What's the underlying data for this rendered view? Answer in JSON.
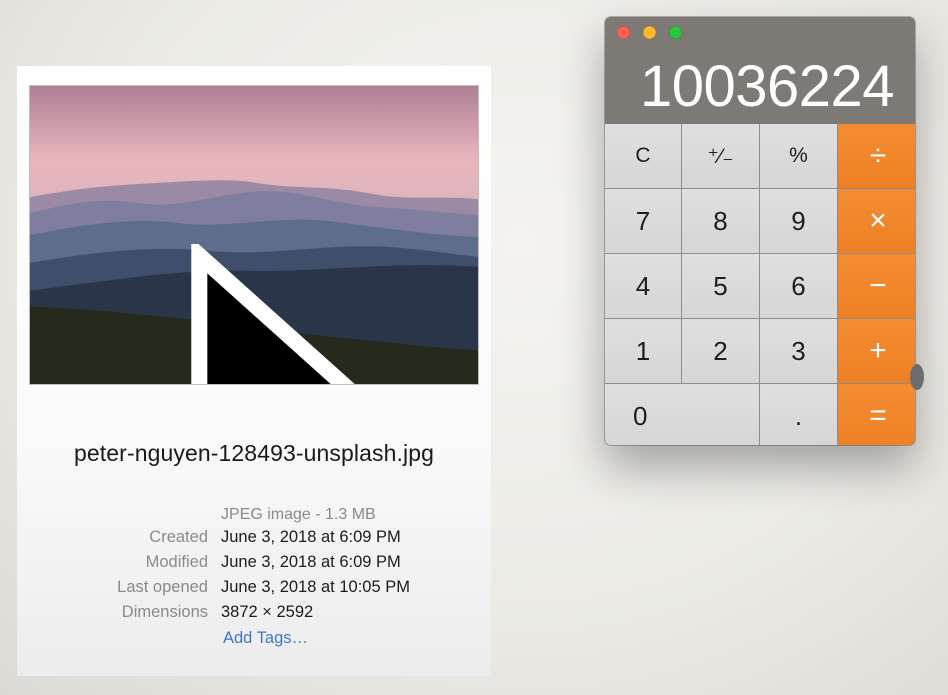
{
  "info_panel": {
    "file_name": "peter-nguyen-128493-unsplash.jpg",
    "kind": "JPEG image - 1.3 MB",
    "metadata": [
      {
        "label": "Created",
        "value": "June 3, 2018 at 6:09 PM"
      },
      {
        "label": "Modified",
        "value": "June 3, 2018 at 6:09 PM"
      },
      {
        "label": "Last opened",
        "value": "June 3, 2018 at 10:05 PM"
      },
      {
        "label": "Dimensions",
        "value": "3872 × 2592"
      }
    ],
    "add_tags": "Add Tags…"
  },
  "calculator": {
    "display": "10036224",
    "keys": {
      "clear": "C",
      "sign": "⁺∕₋",
      "percent": "%",
      "divide": "÷",
      "seven": "7",
      "eight": "8",
      "nine": "9",
      "multiply": "×",
      "four": "4",
      "five": "5",
      "six": "6",
      "minus": "−",
      "one": "1",
      "two": "2",
      "three": "3",
      "plus": "+",
      "zero": "0",
      "decimal": ".",
      "equals": "="
    },
    "colors": {
      "operator": "#f0822a",
      "key": "#d9d9d9",
      "display_bg": "#7d7a75"
    }
  }
}
